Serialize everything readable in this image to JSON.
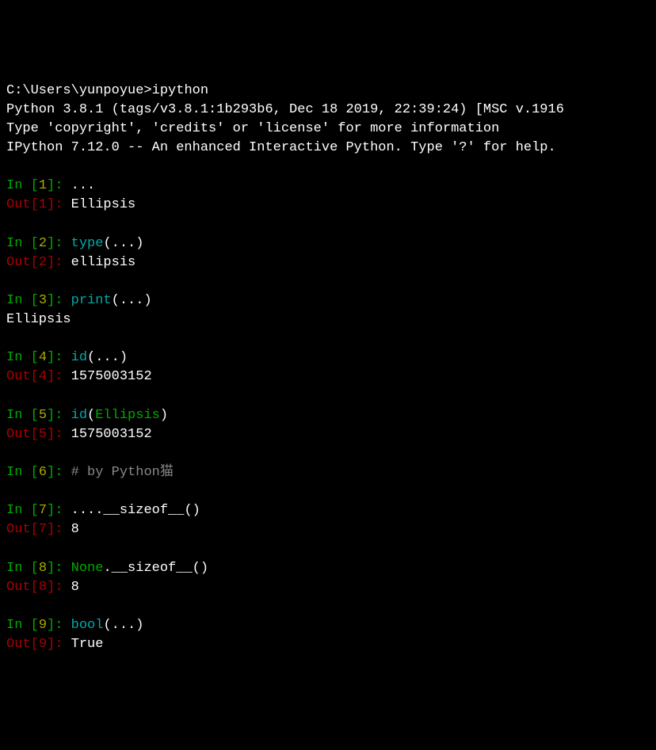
{
  "header": {
    "prompt_path": "C:\\Users\\yunpoyue>",
    "command": "ipython",
    "banner_line1": "Python 3.8.1 (tags/v3.8.1:1b293b6, Dec 18 2019, 22:39:24) [MSC v.1916",
    "banner_line2": "Type 'copyright', 'credits' or 'license' for more information",
    "banner_line3": "IPython 7.12.0 -- An enhanced Interactive Python. Type '?' for help."
  },
  "cells": [
    {
      "n": "1",
      "in_func": "",
      "in_args": "...",
      "out": "Ellipsis",
      "out_kind": "out"
    },
    {
      "n": "2",
      "in_func": "type",
      "in_args": "(...)",
      "out": "ellipsis",
      "out_kind": "out"
    },
    {
      "n": "3",
      "in_func": "print",
      "in_args": "(...)",
      "out": "Ellipsis",
      "out_kind": "stdout"
    },
    {
      "n": "4",
      "in_func": "id",
      "in_args": "(...)",
      "out": "1575003152",
      "out_kind": "out"
    },
    {
      "n": "5",
      "in_func": "id",
      "in_special": "Ellipsis",
      "in_args_pre": "(",
      "in_args_post": ")",
      "out": "1575003152",
      "out_kind": "out"
    },
    {
      "n": "6",
      "comment": "# by Python猫"
    },
    {
      "n": "7",
      "in_func": "",
      "in_args": "....__sizeof__()",
      "out": "8",
      "out_kind": "out"
    },
    {
      "n": "8",
      "in_special": "None",
      "in_args_post": ".__sizeof__()",
      "out": "8",
      "out_kind": "out"
    },
    {
      "n": "9",
      "in_func": "bool",
      "in_args": "(...)",
      "out": "True",
      "out_kind": "out"
    }
  ],
  "tokens": {
    "in_prefix": "In ",
    "out_prefix": "Out",
    "lbrack": "[",
    "rbrack": "]",
    "colon_in": ": ",
    "colon_out": ": "
  }
}
